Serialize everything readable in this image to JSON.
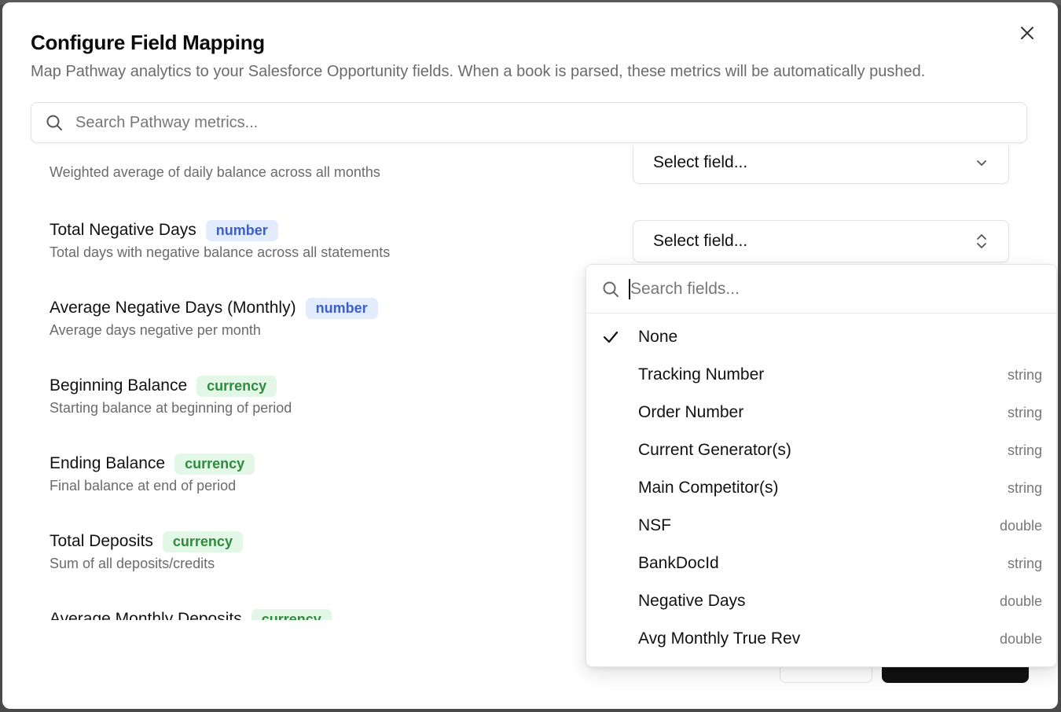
{
  "modal": {
    "title": "Configure Field Mapping",
    "description": "Map Pathway analytics to your Salesforce Opportunity fields. When a book is parsed, these metrics will be automatically pushed.",
    "close_icon": "close-icon"
  },
  "search": {
    "placeholder": "Search Pathway metrics...",
    "icon": "search-icon"
  },
  "metrics": [
    {
      "name": "",
      "type": "",
      "description": "Weighted average of daily balance across all months"
    },
    {
      "name": "Total Negative Days",
      "type": "number",
      "description": "Total days with negative balance across all statements"
    },
    {
      "name": "Average Negative Days (Monthly)",
      "type": "number",
      "description": "Average days negative per month"
    },
    {
      "name": "Beginning Balance",
      "type": "currency",
      "description": "Starting balance at beginning of period"
    },
    {
      "name": "Ending Balance",
      "type": "currency",
      "description": "Final balance at end of period"
    },
    {
      "name": "Total Deposits",
      "type": "currency",
      "description": "Sum of all deposits/credits"
    },
    {
      "name": "Average Monthly Deposits",
      "type": "currency",
      "description": ""
    }
  ],
  "field_select": {
    "label": "Select field...",
    "icon": "chevrons-up-down-icon"
  },
  "dropdown": {
    "search_placeholder": "Search fields...",
    "selected": "None",
    "options": [
      {
        "label": "None",
        "type": ""
      },
      {
        "label": "Tracking Number",
        "type": "string"
      },
      {
        "label": "Order Number",
        "type": "string"
      },
      {
        "label": "Current Generator(s)",
        "type": "string"
      },
      {
        "label": "Main Competitor(s)",
        "type": "string"
      },
      {
        "label": "NSF",
        "type": "double"
      },
      {
        "label": "BankDocId",
        "type": "string"
      },
      {
        "label": "Negative Days",
        "type": "double"
      },
      {
        "label": "Avg Monthly True Rev",
        "type": "double"
      }
    ]
  },
  "colors": {
    "badge_number_bg": "#e3ecfd",
    "badge_number_text": "#3b5fc9",
    "badge_currency_bg": "#e3f7e6",
    "badge_currency_text": "#2f8a3f",
    "primary_button": "#111111"
  }
}
